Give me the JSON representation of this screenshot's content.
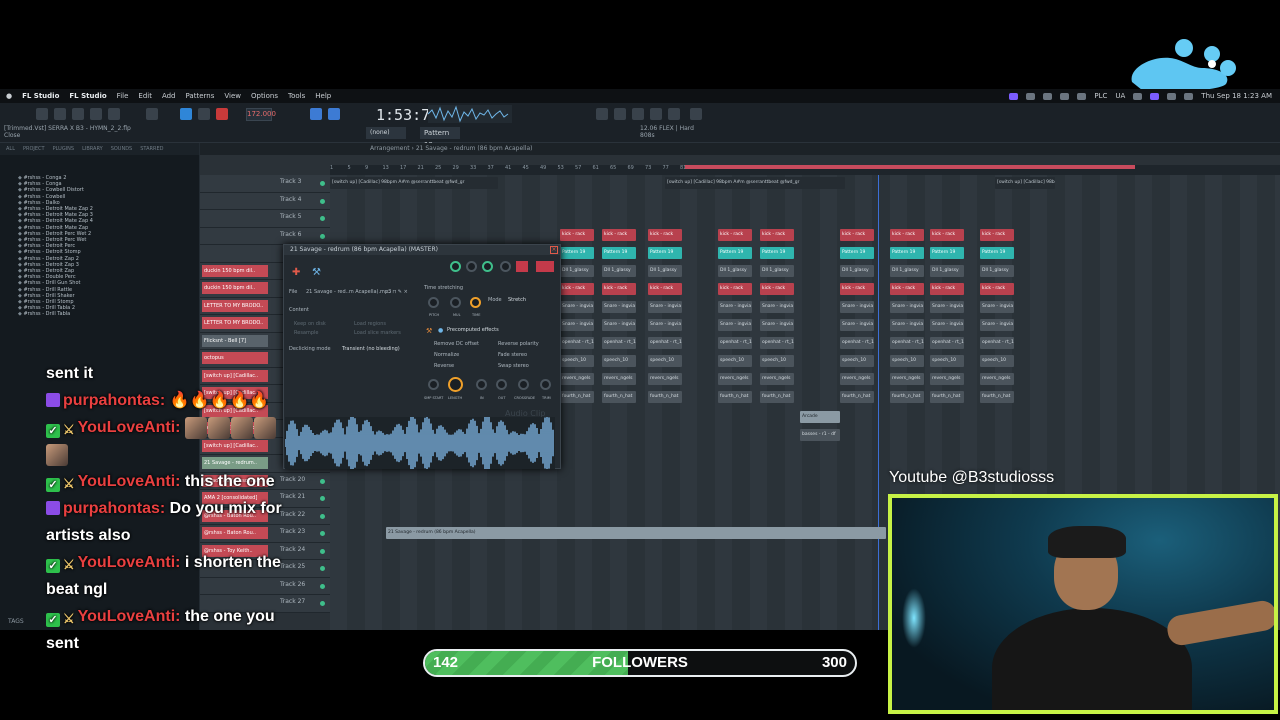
{
  "overlay": {
    "youtube_handle": "Youtube @B3studiosss",
    "followers": {
      "label": "FOLLOWERS",
      "current": "142",
      "goal": "300",
      "progress_fraction": 0.473
    }
  },
  "menubar": {
    "app": "FL Studio",
    "items": [
      "FL Studio",
      "File",
      "Edit",
      "Add",
      "Patterns",
      "View",
      "Options",
      "Tools",
      "Help"
    ],
    "right_text": "PLC",
    "locale": "UA",
    "clock": "Thu Sep 18  1:23 AM"
  },
  "toolbar": {
    "tempo": "172.000",
    "timecode": "1:53:77",
    "hint_line1": "[Trimmed.Vst] SERRA X B3 - HYMN_2_2.flp",
    "hint_line2": "Close",
    "none_select": "(none)",
    "pattern_select": "Pattern 19",
    "flex_line1": "12.06 FLEX | Hard",
    "flex_line2": "808s"
  },
  "browser": {
    "tabs": [
      "ALL",
      "PROJECT",
      "PLUGINS",
      "LIBRARY",
      "SOUNDS",
      "STARRED"
    ],
    "items": [
      "#rshss - Conga 2",
      "#rshss - Conga",
      "#rshss - Cowbell Distort",
      "#rshss - Cowbell",
      "#rshss - Dalko",
      "#rshss - Detroit Mate Zap 2",
      "#rshss - Detroit Mate Zap 3",
      "#rshss - Detroit Mate Zap 4",
      "#rshss - Detroit Mate Zap",
      "#rshss - Detroit Perc Wet 2",
      "#rshss - Detroit Perc Wet",
      "#rshss - Detroit Perc",
      "#rshss - Detroit Stomp",
      "#rshss - Detroit Zap 2",
      "#rshss - Detroit Zap 3",
      "#rshss - Detroit Zap",
      "#rshss - Double Perc",
      "#rshss - Drill Gun Shot",
      "#rshss - Drill Rattle",
      "#rshss - Drill Shaker",
      "#rshss - Drill Stomp",
      "#rshss - Drill Tabla 2",
      "#rshss - Drill Tabla"
    ],
    "tags_label": "TAGS"
  },
  "playlist": {
    "header": "Arrangement  ›  21 Savage - redrum (86 bpm Acapella)",
    "ruler": [
      "1",
      "5",
      "9",
      "13",
      "17",
      "21",
      "25",
      "29",
      "33",
      "37",
      "41",
      "45",
      "49",
      "53",
      "57",
      "61",
      "65",
      "69",
      "73",
      "77",
      "81",
      "85",
      "89",
      "93",
      "97",
      "101",
      "105",
      "109",
      "113",
      "117",
      "121",
      "125",
      "129",
      "133",
      "137",
      "141",
      "145",
      "149",
      "153"
    ],
    "channels": [
      "duckin 150 bpm dil..",
      "duckin 150 bpm dil..",
      "LETTER TO MY BRODO..",
      "LETTER TO MY BRODO..",
      "Flicksnt - Bell [7]",
      "octopus",
      "[switch up] [Cadillac..",
      "[switch up] [Cadillac..",
      "[switch up] [Cadillac..",
      "[switch up] [Cadillac..",
      "[switch up] [Cadillac..",
      "21 Savage - redrum..",
      "Arcade R2 [consolidat..",
      "AMA 2 [consolidated]",
      "@rshss - Baton Rou..",
      "@rshss - Baton Rou..",
      "@rshss - Toy Keith.."
    ],
    "track_names": [
      "Track 3",
      "Track 4",
      "Track 5",
      "Track 6",
      "",
      "",
      "",
      "",
      "",
      "",
      "",
      "",
      "",
      "",
      "",
      "",
      "",
      "Track 20",
      "Track 21",
      "Track 22",
      "Track 23",
      "Track 24",
      "Track 25",
      "Track 26",
      "Track 27"
    ],
    "clip_labels": {
      "switch": "[switch up] [Cadillac] 98bpm A#m @serranttbeat @fwd_gr",
      "pattern": "Pattern 19",
      "kick": "kick - rack",
      "snare": "Snare - ingvia",
      "open": "openhat - rt_10",
      "speech": "speech_10",
      "revers": "revers_ngels",
      "four": "fourth_n_hat",
      "glassy": "Dll 1_glassy",
      "arcade": "Arcade",
      "basses": "basses - r1 - df",
      "redrum": "21 Savage - redrum (86 bpm Acapella)"
    }
  },
  "sample_dialog": {
    "title": "21 Savage - redrum (86 bpm Acapella) (MASTER)",
    "file_label": "File",
    "file_name": "21 Savage - red..m Acapella).mp3",
    "content_label": "Content",
    "keep_on_disk": "Keep on disk",
    "resample": "Resample",
    "load_regions": "Load regions",
    "load_slice": "Load slice markers",
    "declicking_label": "Declicking mode",
    "declicking_value": "Transient (no bleeding)",
    "time_stretching": "Time stretching",
    "mode_label": "Mode",
    "mode_value": "Stretch",
    "precomputed": "Precomputed effects",
    "fx_left": [
      "Remove DC offset",
      "Normalize",
      "Reverse"
    ],
    "fx_right": [
      "Reverse polarity",
      "Fade stereo",
      "Swap stereo"
    ],
    "knob_labels": [
      "PITCH",
      "MUL",
      "TIME"
    ],
    "bottom_knobs": [
      "SMP START",
      "LENGTH",
      "IN",
      "OUT",
      "CROSSFADE",
      "TRIM"
    ],
    "audio_clip": "Audio Clip"
  },
  "chat": [
    {
      "user": "",
      "msg": "sent it",
      "badges": []
    },
    {
      "user": "purpahontas:",
      "msg": "🔥🔥🔥🔥🔥",
      "badges": [
        "purple"
      ]
    },
    {
      "user": "YouLoveAnti:",
      "msg": "",
      "badges": [
        "check",
        "sword"
      ],
      "emotes": 4
    },
    {
      "user": "",
      "msg": "",
      "badges": [],
      "emotes": 1
    },
    {
      "user": "YouLoveAnti:",
      "msg": "this the one",
      "badges": [
        "check",
        "sword"
      ]
    },
    {
      "user": "purpahontas:",
      "msg": "Do you mix for artists also",
      "badges": [
        "purple"
      ]
    },
    {
      "user": "YouLoveAnti:",
      "msg": "i shorten the beat ngl",
      "badges": [
        "check",
        "sword"
      ]
    },
    {
      "user": "YouLoveAnti:",
      "msg": "the one you sent",
      "badges": [
        "check",
        "sword"
      ]
    }
  ],
  "colors": {
    "accent_green": "#4fbe5e",
    "webcam_border": "#c7f246",
    "chat_user": "#e94040"
  }
}
